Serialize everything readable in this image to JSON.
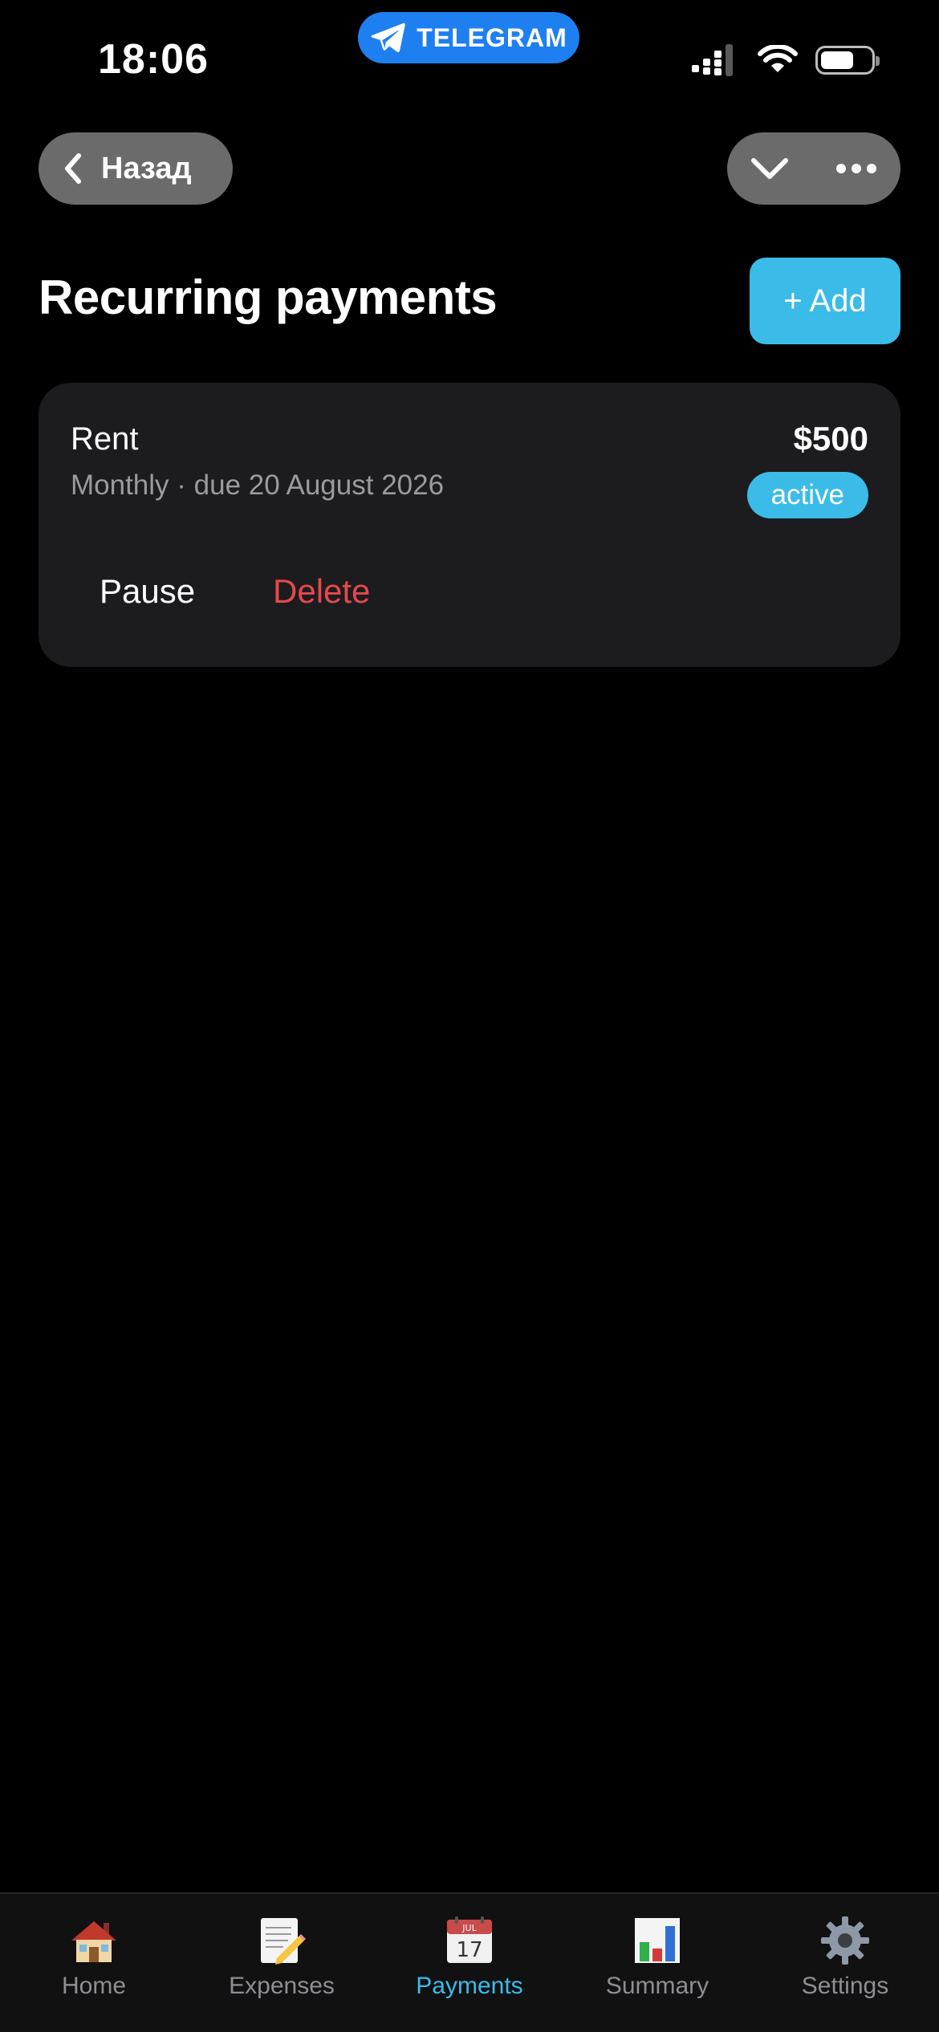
{
  "status_bar": {
    "time": "18:06",
    "app_pill": "TELEGRAM",
    "icons": [
      "signal-icon",
      "wifi-icon",
      "battery-icon"
    ],
    "battery_level": 0.66
  },
  "nav": {
    "back_label": "Назад",
    "icons": [
      "chevron-left-icon",
      "chevron-down-icon",
      "more-icon"
    ]
  },
  "header": {
    "title": "Recurring payments",
    "add_label": "+ Add"
  },
  "payments": [
    {
      "name": "Rent",
      "schedule": "Monthly · due 20 August 2026",
      "amount": "$500",
      "status": "active",
      "pause_label": "Pause",
      "delete_label": "Delete"
    }
  ],
  "tabs": [
    {
      "label": "Home",
      "icon": "house-icon"
    },
    {
      "label": "Expenses",
      "icon": "memo-icon"
    },
    {
      "label": "Payments",
      "icon": "calendar-icon",
      "active": true
    },
    {
      "label": "Summary",
      "icon": "bar-chart-icon"
    },
    {
      "label": "Settings",
      "icon": "gear-icon"
    }
  ],
  "calendar_icon": {
    "month": "JUL",
    "day": "17"
  },
  "colors": {
    "accent": "#3bbbe8",
    "danger": "#e5484d",
    "telegram": "#1e7ff0",
    "card": "#1c1c1e"
  }
}
